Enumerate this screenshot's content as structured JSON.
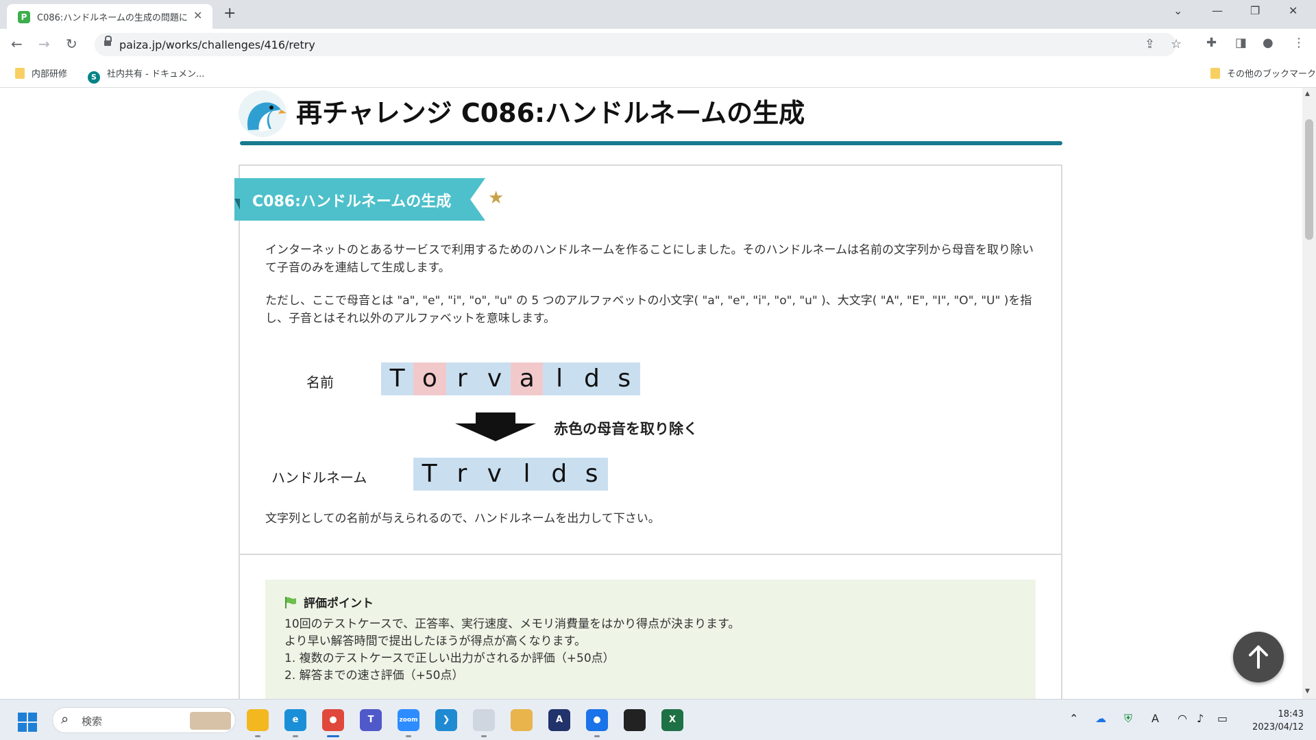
{
  "browser": {
    "tab_title": "C086:ハンドルネームの生成の問題に",
    "tab_favicon": "P",
    "tab_close": "✕",
    "new_tab": "+",
    "url": "paiza.jp/works/challenges/416/retry",
    "window_controls": [
      "⌄",
      "—",
      "❐",
      "✕"
    ],
    "bookmarks": [
      {
        "label": "内部研修",
        "icon": "folder-icon"
      },
      {
        "label": "社内共有 - ドキュメン...",
        "icon": "sharepoint-icon"
      }
    ],
    "other_bookmarks": "その他のブックマーク"
  },
  "page": {
    "heading": "再チャレンジ C086:ハンドルネームの生成",
    "ribbon_title": "C086:ハンドルネームの生成",
    "star": "★",
    "paragraphs": [
      "インターネットのとあるサービスで利用するためのハンドルネームを作ることにしました。そのハンドルネームは名前の文字列から母音を取り除いて子音のみを連結して生成します。",
      "ただし、ここで母音とは \"a\", \"e\", \"i\", \"o\", \"u\" の 5 つのアルファベットの小文字( \"a\", \"e\", \"i\", \"o\", \"u\" )、大文字( \"A\", \"E\", \"I\", \"O\", \"U\" )を指し、子音とはそれ以外のアルファベットを意味します。",
      "文字列としての名前が与えられるので、ハンドルネームを出力して下さい。"
    ],
    "diagram": {
      "name_label": "名前",
      "name_letters": [
        {
          "ch": "T",
          "vowel": false
        },
        {
          "ch": "o",
          "vowel": true
        },
        {
          "ch": "r",
          "vowel": false
        },
        {
          "ch": "v",
          "vowel": false
        },
        {
          "ch": "a",
          "vowel": true
        },
        {
          "ch": "l",
          "vowel": false
        },
        {
          "ch": "d",
          "vowel": false
        },
        {
          "ch": "s",
          "vowel": false
        }
      ],
      "arrow_text": "赤色の母音を取り除く",
      "handle_label": "ハンドルネーム",
      "handle_letters": [
        "T",
        "r",
        "v",
        "l",
        "d",
        "s"
      ]
    },
    "evaluation": {
      "title": "評価ポイント",
      "lines": [
        "10回のテストケースで、正答率、実行速度、メモリ消費量をはかり得点が決まります。",
        "より早い解答時間で提出したほうが得点が高くなります。",
        "  1. 複数のテストケースで正しい出力がされるか評価（+50点）",
        "  2. 解答までの速さ評価（+50点）"
      ]
    },
    "back_to_top": "↑"
  },
  "taskbar": {
    "search_placeholder": "検索",
    "apps": [
      {
        "name": "file-explorer-icon",
        "color": "#f3b81f",
        "glyph": ""
      },
      {
        "name": "edge-icon",
        "color": "#1a8fd8",
        "glyph": "e"
      },
      {
        "name": "chrome-icon",
        "color": "#e0483b",
        "glyph": "●"
      },
      {
        "name": "teams-icon",
        "color": "#5059c9",
        "glyph": "T"
      },
      {
        "name": "zoom-icon",
        "color": "#2d8cff",
        "glyph": "zoom"
      },
      {
        "name": "vscode-icon",
        "color": "#1f8ad2",
        "glyph": "❯"
      },
      {
        "name": "notepad-icon",
        "color": "#cfd6e0",
        "glyph": ""
      },
      {
        "name": "mail-icon",
        "color": "#e9b44c",
        "glyph": ""
      },
      {
        "name": "atok-icon",
        "color": "#22336b",
        "glyph": "A"
      },
      {
        "name": "maps-icon",
        "color": "#1a73e8",
        "glyph": "●"
      },
      {
        "name": "sticky-notes-icon",
        "color": "#222222",
        "glyph": ""
      },
      {
        "name": "excel-icon",
        "color": "#1e7145",
        "glyph": "X"
      }
    ],
    "tray_ime": "A",
    "time": "18:43",
    "date": "2023/04/12"
  },
  "colors": {
    "accent_line": "#177a8e",
    "ribbon": "#4dc0cb",
    "vowel_highlight": "#f2c9cb",
    "letter_bg": "#c9dff0",
    "eval_bg": "#eef4e6"
  }
}
